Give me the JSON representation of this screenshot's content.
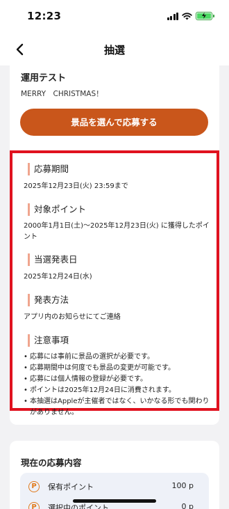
{
  "status_bar": {
    "time": "12:23"
  },
  "nav": {
    "title": "抽選",
    "back_icon": "chevron-left-icon"
  },
  "campaign": {
    "title": "運用テスト",
    "subtitle": "MERRY　CHRISTMAS！",
    "apply_button_label": "景品を選んで応募する",
    "accent_color": "#c9561b"
  },
  "sections": {
    "application_period": {
      "heading": "応募期間",
      "body": "2025年12月23日(火) 23:59まで"
    },
    "target_points": {
      "heading": "対象ポイント",
      "body": "2000年1月1日(土)～2025年12月23日(火) に獲得したポイント"
    },
    "draw_date": {
      "heading": "当選発表日",
      "body": "2025年12月24日(水)"
    },
    "announcement_method": {
      "heading": "発表方法",
      "body": "アプリ内のお知らせにてご連絡"
    },
    "notes": {
      "heading": "注意事項",
      "items": [
        "応募には事前に景品の選択が必要です。",
        "応募期間中は何度でも景品の変更が可能です。",
        "応募には個人情報の登録が必要です。",
        "ポイントは2025年12月24日に消費されます。",
        "本抽選はAppleが主催者ではなく、いかなる形でも関わりがありません。"
      ]
    }
  },
  "current_application": {
    "title": "現在の応募内容",
    "rows": [
      {
        "label": "保有ポイント",
        "value": "100 p",
        "icon": "coin-icon"
      },
      {
        "label": "選択中のポイント",
        "value": "0 p",
        "icon": "coin-icon"
      }
    ]
  },
  "colors": {
    "highlight_border": "#e0121f",
    "heading_marker": "#f0a58e",
    "coin": "#e07a1c"
  }
}
